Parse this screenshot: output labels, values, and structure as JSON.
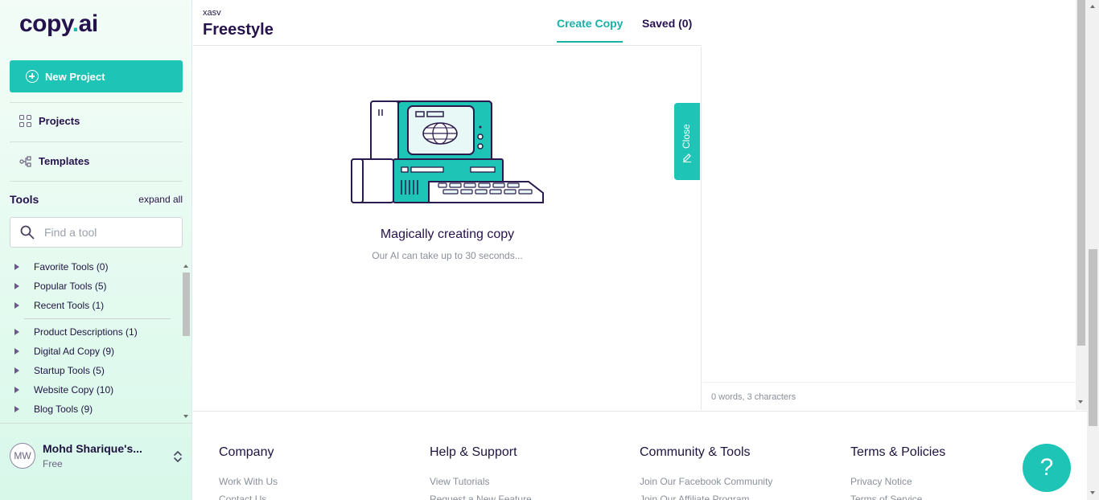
{
  "brand": {
    "logo_main": "copy",
    "logo_dot": ".",
    "logo_tail": "ai",
    "accent": "#1ec4b6"
  },
  "sidebar": {
    "new_project": "New Project",
    "nav": [
      {
        "label": "Projects",
        "icon": "grid-icon"
      },
      {
        "label": "Templates",
        "icon": "templates-icon"
      }
    ],
    "tools_title": "Tools",
    "expand_all": "expand all",
    "search_placeholder": "Find a tool",
    "tool_groups_top": [
      "Favorite Tools (0)",
      "Popular Tools (5)",
      "Recent Tools (1)"
    ],
    "tool_groups": [
      "Product Descriptions (1)",
      "Digital Ad Copy (9)",
      "Startup Tools (5)",
      "Website Copy (10)",
      "Blog Tools (9)"
    ],
    "user": {
      "initials": "MW",
      "name": "Mohd Sharique's...",
      "plan": "Free"
    }
  },
  "header": {
    "subtitle": "xasv",
    "title": "Freestyle",
    "tab_create": "Create Copy",
    "tab_saved": "Saved (0)"
  },
  "main": {
    "loading_title": "Magically creating copy",
    "loading_sub": "Our AI can take up to 30 seconds...",
    "close_label": "Close"
  },
  "editor": {
    "stats": "0 words, 3 characters"
  },
  "footer": {
    "company": {
      "title": "Company",
      "links": [
        "Work With Us",
        "Contact Us"
      ]
    },
    "help": {
      "title": "Help & Support",
      "links": [
        "View Tutorials",
        "Request a New Feature"
      ]
    },
    "community": {
      "title": "Community & Tools",
      "links": [
        "Join Our Facebook Community",
        "Join Our Affiliate Program"
      ]
    },
    "terms": {
      "title": "Terms & Policies",
      "links": [
        "Privacy Notice",
        "Terms of Service"
      ]
    },
    "help_button": "?"
  }
}
